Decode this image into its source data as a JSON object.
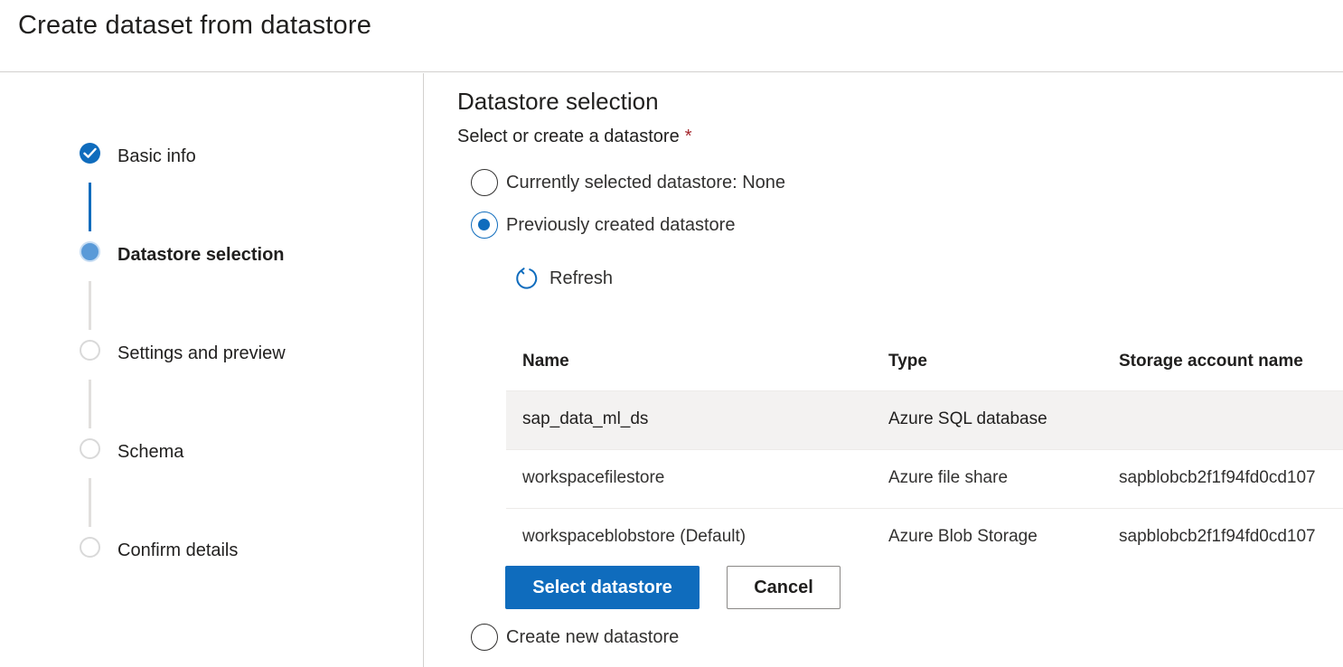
{
  "header": {
    "title": "Create dataset from datastore"
  },
  "steps": [
    {
      "label": "Basic info",
      "state": "completed"
    },
    {
      "label": "Datastore selection",
      "state": "current"
    },
    {
      "label": "Settings and preview",
      "state": "pending"
    },
    {
      "label": "Schema",
      "state": "pending"
    },
    {
      "label": "Confirm details",
      "state": "pending"
    }
  ],
  "main": {
    "section_title": "Datastore selection",
    "field_label": "Select or create a datastore",
    "required_mark": "*",
    "options": [
      {
        "label": "Currently selected datastore: None",
        "checked": false
      },
      {
        "label": "Previously created datastore",
        "checked": true
      },
      {
        "label": "Create new datastore",
        "checked": false
      }
    ],
    "refresh_label": "Refresh",
    "table": {
      "columns": [
        "Name",
        "Type",
        "Storage account name"
      ],
      "rows": [
        {
          "name": "sap_data_ml_ds",
          "type": "Azure SQL database",
          "storage": "",
          "selected": true
        },
        {
          "name": "workspacefilestore",
          "type": "Azure file share",
          "storage": "sapblobcb2f1f94fd0cd107",
          "selected": false
        },
        {
          "name": "workspaceblobstore (Default)",
          "type": "Azure Blob Storage",
          "storage": "sapblobcb2f1f94fd0cd107",
          "selected": false
        }
      ]
    },
    "select_button": "Select datastore",
    "cancel_button": "Cancel"
  },
  "colors": {
    "accent": "#0f6cbd",
    "current_step": "#5a9ad8",
    "selected_row": "#f3f2f1",
    "required": "#a4262c"
  },
  "icons": {
    "completed_step": "checkmark-icon",
    "refresh": "refresh-icon"
  }
}
